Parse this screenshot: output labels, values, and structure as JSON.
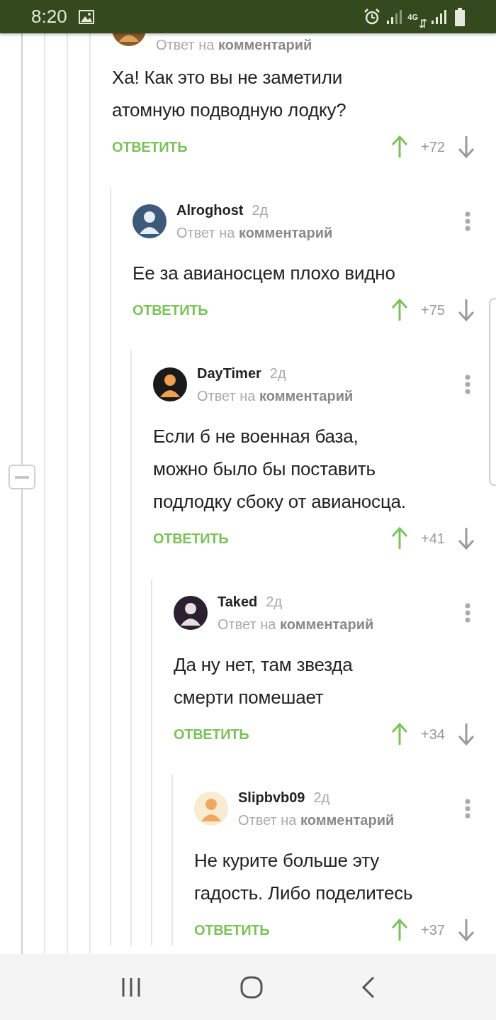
{
  "status_bar": {
    "time": "8:20",
    "network": "4G"
  },
  "comments": [
    {
      "kind": "cut-off",
      "reply_to": "Ответ на **комментарий**",
      "body_lines": [
        "Ха! Как это вы не заметили",
        "атомную подводную лодку?"
      ],
      "reply_label": "ОТВЕТИТЬ",
      "score": "+72",
      "children": [
        {
          "author": "Alroghost",
          "time": "2д",
          "reply_to": "Ответ на **комментарий**",
          "body_lines": [
            "Ее за авианосцем плохо видно"
          ],
          "reply_label": "ОТВЕТИТЬ",
          "score": "+75",
          "children": [
            {
              "author": "DayTimer",
              "time": "2д",
              "reply_to": "Ответ на **комментарий**",
              "body_lines": [
                "Если б не военная база,",
                "можно было бы поставить",
                "подлодку сбоку от авианосца."
              ],
              "reply_label": "ОТВЕТИТЬ",
              "score": "+41",
              "children": [
                {
                  "author": "Taked",
                  "time": "2д",
                  "reply_to": "Ответ на **комментарий**",
                  "body_lines": [
                    "Да ну нет, там звезда",
                    "смерти помешает"
                  ],
                  "reply_label": "ОТВЕТИТЬ",
                  "score": "+34",
                  "children": [
                    {
                      "author": "Slipbvb09",
                      "time": "2д",
                      "reply_to": "Ответ на **комментарий**",
                      "body_lines": [
                        "Не курите больше эту",
                        "гадость. Либо поделитесь"
                      ],
                      "reply_label": "ОТВЕТИТЬ",
                      "score": "+37"
                    }
                  ]
                }
              ]
            }
          ]
        }
      ]
    }
  ]
}
